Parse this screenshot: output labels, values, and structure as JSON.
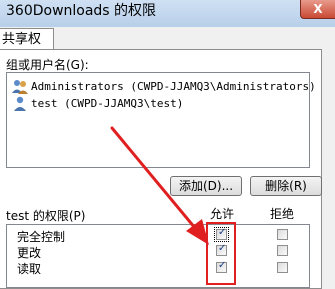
{
  "window": {
    "title": "360Downloads 的权限",
    "close_label": "X"
  },
  "tabs": [
    {
      "label": "共享权限"
    }
  ],
  "users_section": {
    "label": "组或用户名(G):",
    "items": [
      {
        "label": "Administrators (CWPD-JJAMQ3\\Administrators)",
        "icon": "user-group-icon"
      },
      {
        "label": "test (CWPD-JJAMQ3\\test)",
        "icon": "user-icon"
      }
    ]
  },
  "buttons": {
    "add": "添加(D)...",
    "remove": "删除(R)"
  },
  "permissions": {
    "label": "test 的权限(P)",
    "allow_header": "允许",
    "deny_header": "拒绝",
    "rows": [
      {
        "name": "完全控制",
        "allow": true,
        "deny": false
      },
      {
        "name": "更改",
        "allow": true,
        "deny": false
      },
      {
        "name": "读取",
        "allow": true,
        "deny": false
      }
    ]
  },
  "colors": {
    "annotation": "#e02020",
    "title_bar": "#c4d8ef"
  }
}
